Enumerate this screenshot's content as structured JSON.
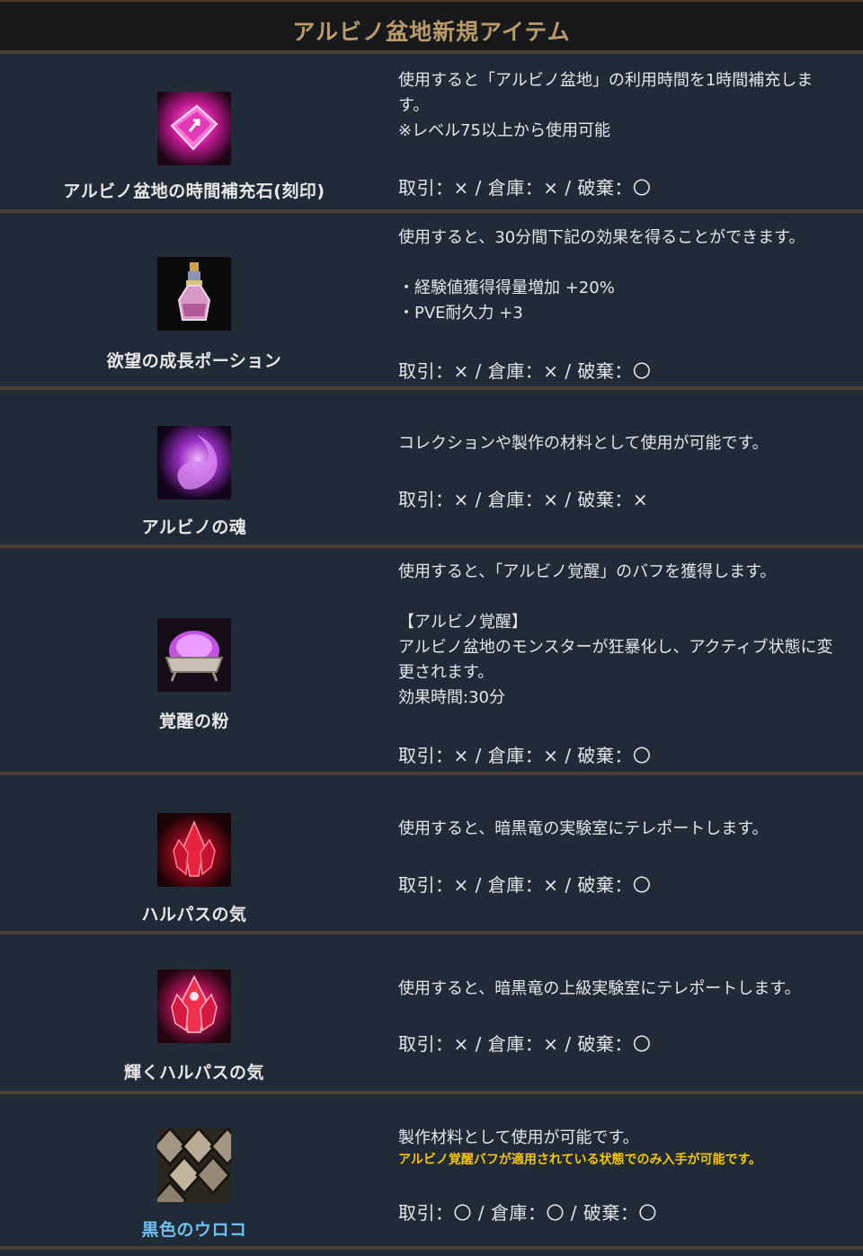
{
  "title": "アルビノ盆地新規アイテム",
  "items": [
    {
      "name": "アルビノ盆地の時間補充石(刻印)",
      "icon": "pink-rune-stone-icon",
      "desc": [
        "使用すると「アルビノ盆地」の利用時間を1時間補充しま",
        "す。",
        "※レベル75以上から使用可能"
      ],
      "trade": "取引：× / 倉庫：× / 破棄：〇"
    },
    {
      "name": "欲望の成長ポーション",
      "icon": "potion-bottle-icon",
      "desc": [
        "使用すると、30分間下記の効果を得ることができます。",
        "",
        "・経験値獲得得量増加 +20%",
        "・PVE耐久力 +3"
      ],
      "trade": "取引：× / 倉庫：× / 破棄：〇"
    },
    {
      "name": "アルビノの魂",
      "icon": "purple-soul-icon",
      "desc": [
        "コレクションや製作の材料として使用が可能です。"
      ],
      "trade": "取引：× / 倉庫：× / 破棄：×"
    },
    {
      "name": "覚醒の粉",
      "icon": "powder-bowl-icon",
      "desc": [
        "使用すると、「アルビノ覚醒」のバフを獲得します。",
        "",
        "【アルビノ覚醒】",
        "アルビノ盆地のモンスターが狂暴化し、アクティブ状態に変",
        "更されます。",
        "効果時間:30分"
      ],
      "trade": "取引：× / 倉庫：× / 破棄：〇"
    },
    {
      "name": "ハルパスの気",
      "icon": "red-crystal-icon",
      "desc": [
        "使用すると、暗黒竜の実験室にテレポートします。"
      ],
      "trade": "取引：× / 倉庫：× / 破棄：〇"
    },
    {
      "name": "輝くハルパスの気",
      "icon": "shining-red-crystal-icon",
      "desc": [
        "使用すると、暗黒竜の上級実験室にテレポートします。"
      ],
      "trade": "取引：× / 倉庫：× / 破棄：〇"
    },
    {
      "name": "黒色のウロコ",
      "icon": "black-scales-icon",
      "desc": [
        "製作材料として使用が可能です。"
      ],
      "note": "アルビノ覚醒バフが適用されている状態でのみ入手が可能です。",
      "trade": "取引：〇 / 倉庫：〇 / 破棄：〇"
    }
  ],
  "colors": {
    "header_text": "#b99a6a",
    "row_bg": "#202b37",
    "divider": "#4a3f33",
    "note": "#f2c400",
    "highlight_name": "#6cc0ef"
  }
}
